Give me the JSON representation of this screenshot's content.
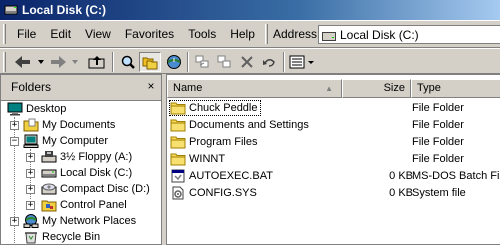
{
  "window": {
    "title": "Local Disk (C:)"
  },
  "menu": [
    "File",
    "Edit",
    "View",
    "Favorites",
    "Tools",
    "Help"
  ],
  "address": {
    "label": "Address",
    "value": "Local Disk (C:)"
  },
  "folders_pane": {
    "title": "Folders",
    "close_glyph": "×"
  },
  "tree": [
    {
      "label": "Desktop",
      "icon": "desktop-icon",
      "expander": ""
    },
    {
      "label": "My Documents",
      "icon": "my-documents-icon",
      "expander": "+"
    },
    {
      "label": "My Computer",
      "icon": "my-computer-icon",
      "expander": "−"
    },
    {
      "label": "3½ Floppy (A:)",
      "icon": "floppy-drive-icon",
      "expander": "+"
    },
    {
      "label": "Local Disk (C:)",
      "icon": "hard-drive-icon",
      "expander": "+"
    },
    {
      "label": "Compact Disc (D:)",
      "icon": "cd-drive-icon",
      "expander": "+"
    },
    {
      "label": "Control Panel",
      "icon": "control-panel-icon",
      "expander": "+"
    },
    {
      "label": "My Network Places",
      "icon": "network-places-icon",
      "expander": "+"
    },
    {
      "label": "Recycle Bin",
      "icon": "recycle-bin-icon",
      "expander": ""
    }
  ],
  "columns": {
    "name": "Name",
    "size": "Size",
    "type": "Type",
    "sort_glyph": "▲"
  },
  "files": [
    {
      "name": "Chuck Peddle",
      "size": "",
      "type": "File Folder",
      "icon": "folder-icon"
    },
    {
      "name": "Documents and Settings",
      "size": "",
      "type": "File Folder",
      "icon": "folder-icon"
    },
    {
      "name": "Program Files",
      "size": "",
      "type": "File Folder",
      "icon": "folder-icon"
    },
    {
      "name": "WINNT",
      "size": "",
      "type": "File Folder",
      "icon": "folder-icon"
    },
    {
      "name": "AUTOEXEC.BAT",
      "size": "0 KB",
      "type": "MS-DOS Batch File",
      "icon": "batch-file-icon"
    },
    {
      "name": "CONFIG.SYS",
      "size": "0 KB",
      "type": "System file",
      "icon": "system-file-icon"
    }
  ]
}
